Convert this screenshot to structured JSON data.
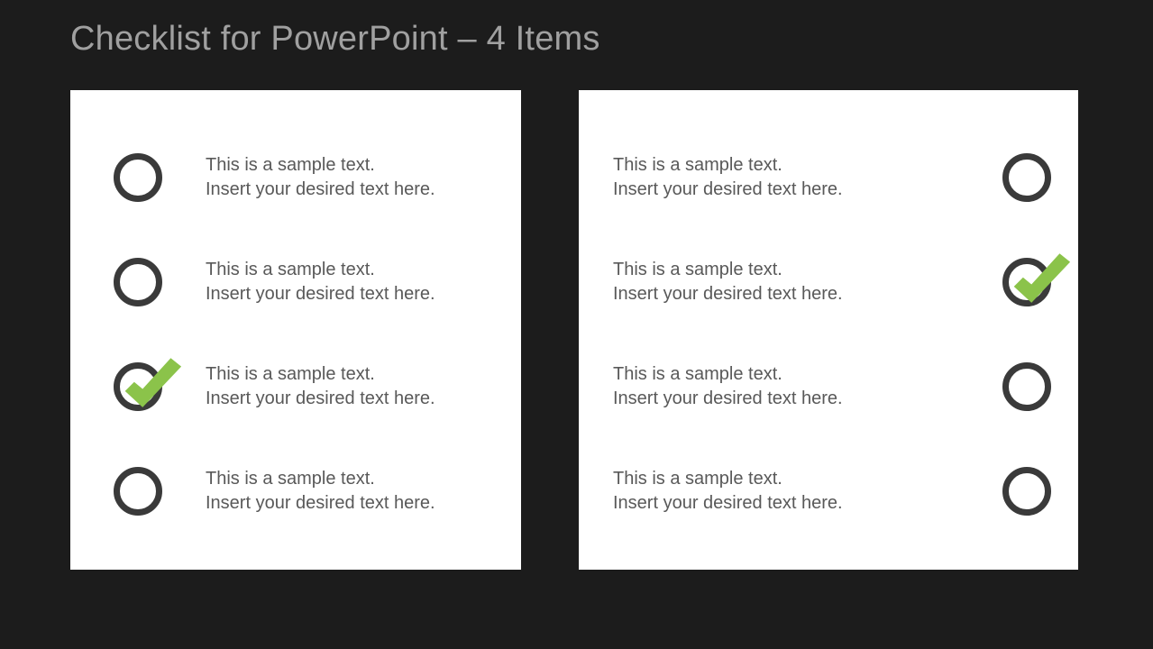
{
  "title": "Checklist for PowerPoint – 4 Items",
  "leftPanel": {
    "items": [
      {
        "line1": "This is a sample text.",
        "line2": "Insert your desired text here.",
        "checked": false
      },
      {
        "line1": "This is a sample text.",
        "line2": "Insert your desired text here.",
        "checked": false
      },
      {
        "line1": "This is a sample text.",
        "line2": "Insert your desired text here.",
        "checked": true
      },
      {
        "line1": "This is a sample text.",
        "line2": "Insert your desired text here.",
        "checked": false
      }
    ]
  },
  "rightPanel": {
    "items": [
      {
        "line1": "This is a sample text.",
        "line2": "Insert your desired text here.",
        "checked": false
      },
      {
        "line1": "This is a sample text.",
        "line2": "Insert your desired text here.",
        "checked": true
      },
      {
        "line1": "This is a sample text.",
        "line2": "Insert your desired text here.",
        "checked": false
      },
      {
        "line1": "This is a sample text.",
        "line2": "Insert your desired text here.",
        "checked": false
      }
    ]
  },
  "colors": {
    "check": "#8bc34a"
  }
}
